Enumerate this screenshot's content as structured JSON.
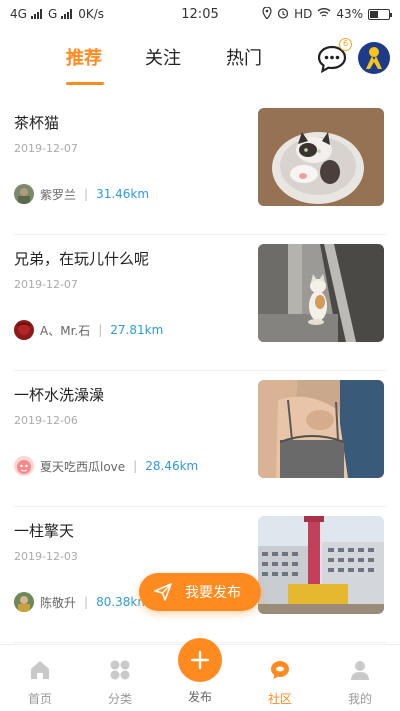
{
  "status_bar": {
    "network_left": "4G",
    "network_right": "G",
    "speed": "0K/s",
    "time": "12:05",
    "hd": "HD",
    "battery": "43%",
    "battery_level": 0.43
  },
  "tabs": [
    {
      "label": "推荐",
      "active": true
    },
    {
      "label": "关注",
      "active": false
    },
    {
      "label": "热门",
      "active": false
    }
  ],
  "message_badge": "6",
  "posts": [
    {
      "title": "茶杯猫",
      "date": "2019-12-07",
      "author": "紫罗兰",
      "distance": "31.46km",
      "image": "kitten-in-cup"
    },
    {
      "title": "兄弟，在玩儿什么呢",
      "date": "2019-12-07",
      "author": "A、Mr.石",
      "distance": "27.81km",
      "image": "cat-by-door"
    },
    {
      "title": "一杯水洗澡澡",
      "date": "2019-12-06",
      "author": "夏天吃西瓜love",
      "distance": "28.46km",
      "image": "woman-photo"
    },
    {
      "title": "一柱擎天",
      "date": "2019-12-03",
      "author": "陈敬升",
      "distance": "80.38km",
      "image": "crane-building"
    }
  ],
  "float_button": {
    "label": "我要发布",
    "icon": "paper-plane-icon"
  },
  "bottom_nav": [
    {
      "label": "首页",
      "icon": "home-icon",
      "active": false
    },
    {
      "label": "分类",
      "icon": "category-icon",
      "active": false
    },
    {
      "label": "发布",
      "icon": "plus-icon",
      "active": false
    },
    {
      "label": "社区",
      "icon": "community-icon",
      "active": true
    },
    {
      "label": "我的",
      "icon": "user-icon",
      "active": false
    }
  ],
  "colors": {
    "accent": "#ff8a1f",
    "distance": "#2e9bd6"
  }
}
